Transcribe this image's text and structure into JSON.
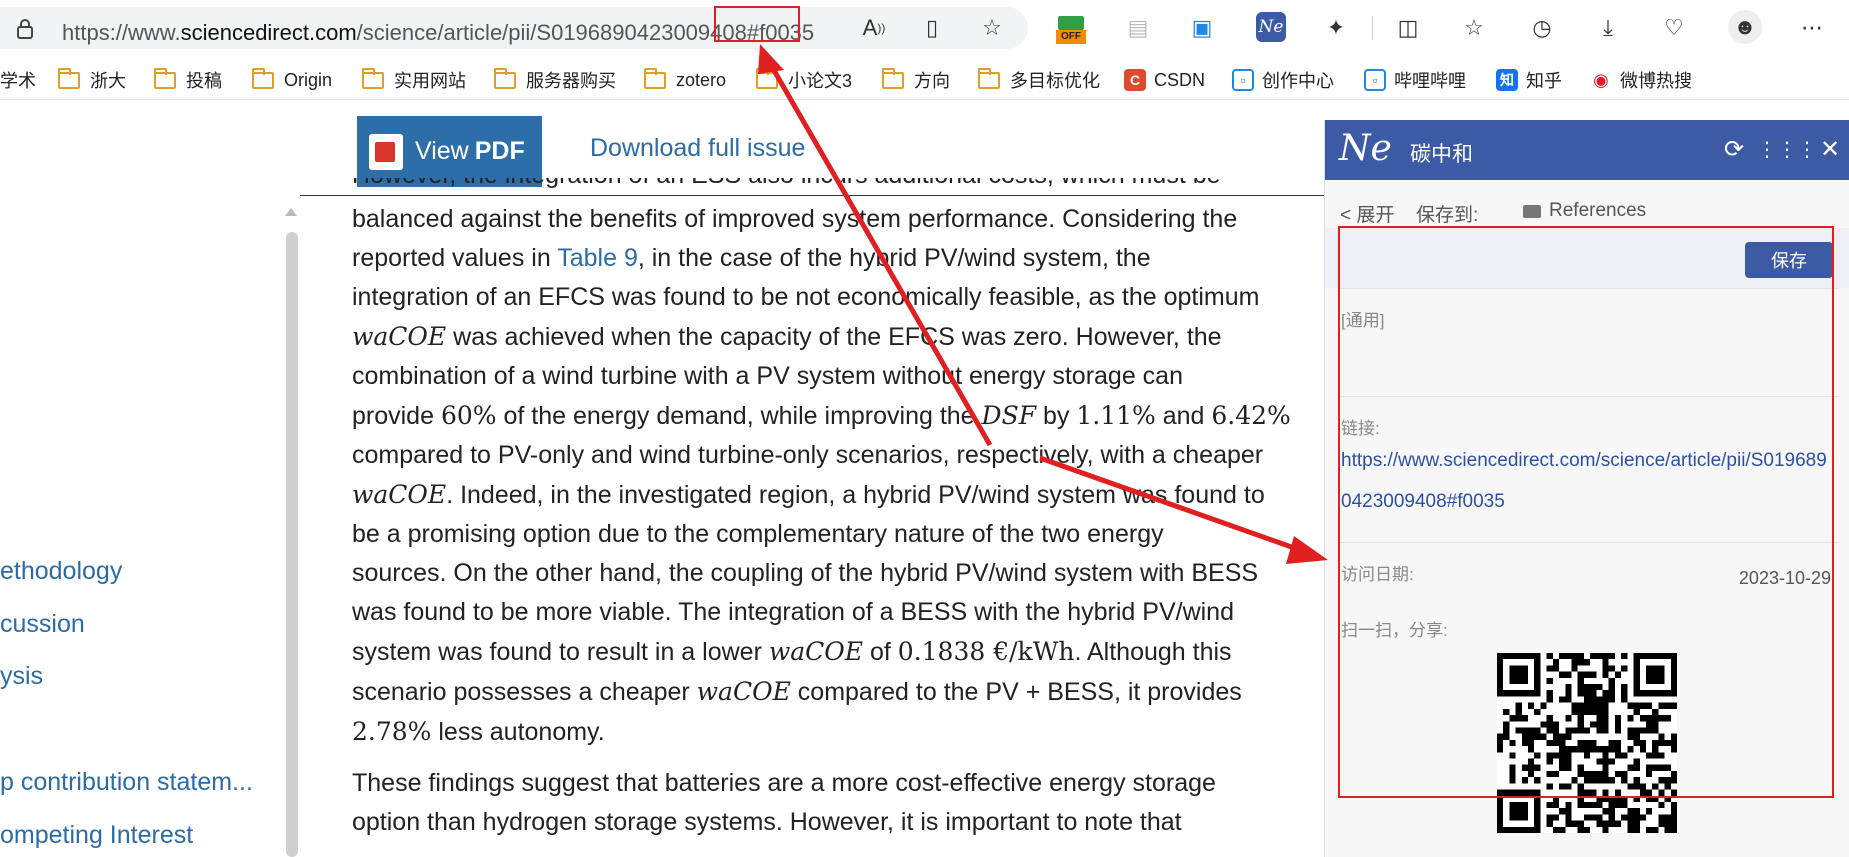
{
  "browser": {
    "url_prefix": "https://www.",
    "url_domain": "sciencedirect.com",
    "url_path": "/science/article/pii/S0196890423009408",
    "url_fragment": "#f0035",
    "toolbar_icons": [
      "read-aloud-icon",
      "immersive-reader-icon",
      "favorite-star-icon",
      "off-extension-icon",
      "document-icon",
      "bilibili-icon",
      "ne-extension-icon",
      "extensions-icon",
      "split-screen-icon",
      "favorites-icon",
      "history-icon",
      "download-icon",
      "health-icon",
      "profile-avatar-icon",
      "more-icon"
    ],
    "off_badge": "OFF"
  },
  "bookmarks": [
    {
      "label": "学术",
      "type": "text"
    },
    {
      "label": "浙大",
      "type": "folder"
    },
    {
      "label": "投稿",
      "type": "folder"
    },
    {
      "label": "Origin",
      "type": "folder"
    },
    {
      "label": "实用网站",
      "type": "folder"
    },
    {
      "label": "服务器购买",
      "type": "folder"
    },
    {
      "label": "zotero",
      "type": "folder"
    },
    {
      "label": "小论文3",
      "type": "folder"
    },
    {
      "label": "方向",
      "type": "folder"
    },
    {
      "label": "多目标优化",
      "type": "folder"
    },
    {
      "label": "CSDN",
      "type": "csdn"
    },
    {
      "label": "创作中心",
      "type": "bili"
    },
    {
      "label": "哔哩哔哩",
      "type": "bili"
    },
    {
      "label": "知乎",
      "type": "zhihu"
    },
    {
      "label": "微博热搜",
      "type": "weibo"
    }
  ],
  "pdf_bar": {
    "view_pdf_prefix": "View ",
    "view_pdf_bold": "PDF",
    "download_label": "Download full issue"
  },
  "left_nav": [
    "ethodology",
    "cussion",
    "ysis",
    "p contribution statem...",
    "ompeting Interest"
  ],
  "article": {
    "cut_line": "However, the integration of an ESS also incurs additional costs, which must be",
    "p1": [
      "balanced against the benefits of improved system performance. Considering the",
      "reported values in ",
      "Table 9",
      ", in the case of the hybrid PV/wind system, the",
      "integration of an EFCS was found to be not economically feasible, as the optimum",
      "waCOE",
      " was achieved when the capacity of the EFCS was zero. However, the",
      "combination of a wind turbine with a PV system without energy storage can",
      "provide ",
      "60%",
      " of the energy demand, while improving the ",
      "DSF",
      " by ",
      "1.11%",
      " and ",
      "6.42%",
      "compared to PV-only and wind turbine-only scenarios, respectively, with a cheaper",
      "waCOE",
      ". Indeed, in the investigated region, a hybrid PV/wind system was found to",
      "be a promising option due to the complementary nature of the two energy",
      "sources. On the other hand, the coupling of the hybrid PV/wind system with BESS",
      "was found to be more viable. The integration of a BESS with the hybrid PV/wind",
      "system was found to result in a lower ",
      "waCOE",
      " of ",
      "0.1838  €/kWh",
      ". Although this",
      "scenario possesses a cheaper ",
      "waCOE",
      " compared to the PV + BESS, it provides",
      "2.78%",
      " less autonomy."
    ],
    "p2": [
      "These findings suggest that batteries are a more cost-effective energy storage",
      "option than hydrogen storage systems. However, it is important to note that"
    ]
  },
  "panel": {
    "logo": "Ne",
    "title": "碳中和",
    "expand": "< 展开",
    "save_to": "保存到:",
    "folder": "References",
    "save_button": "保存",
    "tag": "[通用]",
    "link_label": "链接:",
    "link_value": "https://www.sciencedirect.com/science/article/pii/S0196890423009408#f0035",
    "date_label": "访问日期:",
    "date_value": "2023-10-29",
    "share_label": "扫一扫，分享:"
  },
  "colors": {
    "accent": "#3d5aa5",
    "link": "#2c6ba6",
    "annotation": "#e02020"
  }
}
